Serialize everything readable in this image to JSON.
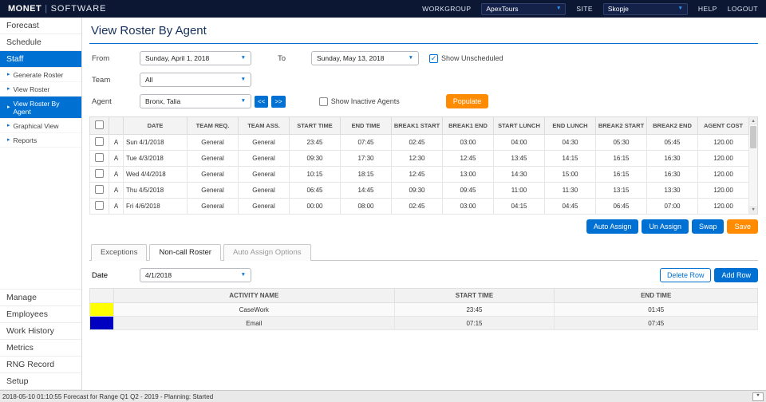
{
  "colors": {
    "accent_blue": "#0070d2",
    "action_orange": "#ff8c00",
    "topbar_bg": "#0b1733",
    "casework_swatch": "#ffff00",
    "email_swatch": "#0000c0"
  },
  "topbar": {
    "brand_primary": "MONET",
    "brand_secondary": "SOFTWARE",
    "workgroup_label": "WORKGROUP",
    "workgroup_value": "ApexTours",
    "site_label": "SITE",
    "site_value": "Skopje",
    "help_label": "HELP",
    "logout_label": "LOGOUT"
  },
  "sidebar": {
    "top_items": [
      {
        "label": "Forecast",
        "active": false
      },
      {
        "label": "Schedule",
        "active": false
      },
      {
        "label": "Staff",
        "active": true
      }
    ],
    "sub_items": [
      {
        "label": "Generate Roster",
        "active": false
      },
      {
        "label": "View Roster",
        "active": false
      },
      {
        "label": "View Roster By Agent",
        "active": true
      },
      {
        "label": "Graphical View",
        "active": false
      },
      {
        "label": "Reports",
        "active": false
      }
    ],
    "bottom_items": [
      {
        "label": "Manage"
      },
      {
        "label": "Employees"
      },
      {
        "label": "Work History"
      },
      {
        "label": "Metrics"
      },
      {
        "label": "RNG Record"
      },
      {
        "label": "Setup"
      }
    ]
  },
  "page": {
    "title": "View Roster By Agent"
  },
  "filters": {
    "from_label": "From",
    "from_value": "Sunday, April 1, 2018",
    "to_label": "To",
    "to_value": "Sunday, May 13, 2018",
    "show_unscheduled_label": "Show Unscheduled",
    "show_unscheduled_checked": true,
    "team_label": "Team",
    "team_value": "All",
    "agent_label": "Agent",
    "agent_value": "Bronx, Talia",
    "prev_agent_label": "<<",
    "next_agent_label": ">>",
    "show_inactive_label": "Show Inactive Agents",
    "show_inactive_checked": false,
    "populate_label": "Populate"
  },
  "roster_table": {
    "headers": [
      "DATE",
      "TEAM REQ.",
      "TEAM ASS.",
      "START TIME",
      "END TIME",
      "BREAK1 START",
      "BREAK1 END",
      "START LUNCH",
      "END LUNCH",
      "BREAK2 START",
      "BREAK2 END",
      "AGENT COST"
    ],
    "rows": [
      {
        "flag": "A",
        "date": "Sun 4/1/2018",
        "cells": [
          "General",
          "General",
          "23:45",
          "07:45",
          "02:45",
          "03:00",
          "04:00",
          "04:30",
          "05:30",
          "05:45",
          "120.00"
        ]
      },
      {
        "flag": "A",
        "date": "Tue 4/3/2018",
        "cells": [
          "General",
          "General",
          "09:30",
          "17:30",
          "12:30",
          "12:45",
          "13:45",
          "14:15",
          "16:15",
          "16:30",
          "120.00"
        ]
      },
      {
        "flag": "A",
        "date": "Wed 4/4/2018",
        "cells": [
          "General",
          "General",
          "10:15",
          "18:15",
          "12:45",
          "13:00",
          "14:30",
          "15:00",
          "16:15",
          "16:30",
          "120.00"
        ]
      },
      {
        "flag": "A",
        "date": "Thu 4/5/2018",
        "cells": [
          "General",
          "General",
          "06:45",
          "14:45",
          "09:30",
          "09:45",
          "11:00",
          "11:30",
          "13:15",
          "13:30",
          "120.00"
        ]
      },
      {
        "flag": "A",
        "date": "Fri 4/6/2018",
        "cells": [
          "General",
          "General",
          "00:00",
          "08:00",
          "02:45",
          "03:00",
          "04:15",
          "04:45",
          "06:45",
          "07:00",
          "120.00"
        ]
      }
    ]
  },
  "roster_actions": {
    "auto_assign_label": "Auto Assign",
    "un_assign_label": "Un Assign",
    "swap_label": "Swap",
    "save_label": "Save"
  },
  "tabs": [
    {
      "label": "Exceptions",
      "active": false,
      "disabled": false
    },
    {
      "label": "Non-call Roster",
      "active": true,
      "disabled": false
    },
    {
      "label": "Auto Assign Options",
      "active": false,
      "disabled": true
    }
  ],
  "noncall_panel": {
    "date_label": "Date",
    "date_value": "4/1/2018",
    "delete_row_label": "Delete Row",
    "add_row_label": "Add Row",
    "headers": [
      "ACTIVITY NAME",
      "START TIME",
      "END TIME"
    ],
    "rows": [
      {
        "color": "#ffff00",
        "activity": "CaseWork",
        "start": "23:45",
        "end": "01:45"
      },
      {
        "color": "#0000c0",
        "activity": "Email",
        "start": "07:15",
        "end": "07:45"
      }
    ]
  },
  "statusbar": {
    "text": "2018-05-10 01:10:55 Forecast for Range Q1 Q2 - 2019 - Planning: Started"
  }
}
